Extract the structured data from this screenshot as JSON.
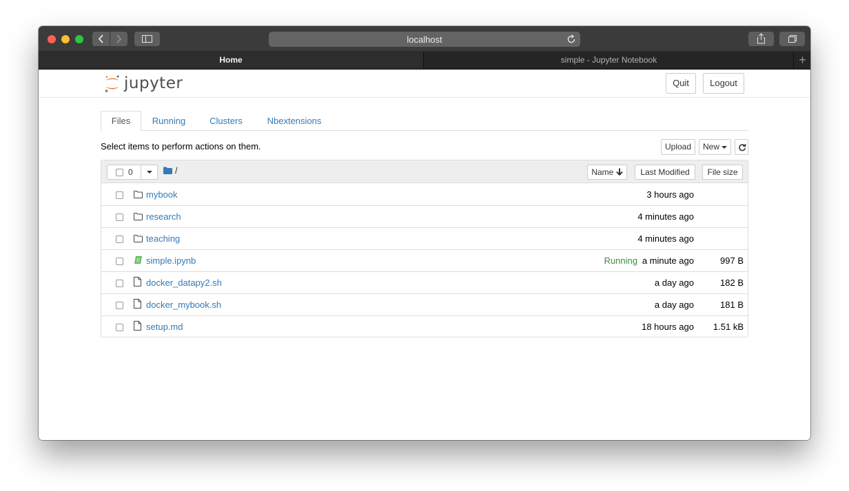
{
  "browser": {
    "url": "localhost",
    "tabs": [
      {
        "label": "Home",
        "active": true
      },
      {
        "label": "simple - Jupyter Notebook",
        "active": false
      }
    ],
    "add_tab_symbol": "+"
  },
  "header": {
    "logo_text": "jupyter",
    "quit_label": "Quit",
    "logout_label": "Logout"
  },
  "nav_tabs": [
    {
      "label": "Files"
    },
    {
      "label": "Running"
    },
    {
      "label": "Clusters"
    },
    {
      "label": "Nbextensions"
    }
  ],
  "toolbar": {
    "instruction": "Select items to perform actions on them.",
    "upload_label": "Upload",
    "new_label": "New"
  },
  "list_header": {
    "selected_count": "0",
    "path": "/",
    "sort_name_label": "Name",
    "sort_modified_label": "Last Modified",
    "sort_size_label": "File size"
  },
  "items": [
    {
      "name": "mybook",
      "type": "folder",
      "status": "",
      "modified": "3 hours ago",
      "size": ""
    },
    {
      "name": "research",
      "type": "folder",
      "status": "",
      "modified": "4 minutes ago",
      "size": ""
    },
    {
      "name": "teaching",
      "type": "folder",
      "status": "",
      "modified": "4 minutes ago",
      "size": ""
    },
    {
      "name": "simple.ipynb",
      "type": "notebook",
      "status": "Running",
      "modified": "a minute ago",
      "size": "997 B"
    },
    {
      "name": "docker_datapy2.sh",
      "type": "file",
      "status": "",
      "modified": "a day ago",
      "size": "182 B"
    },
    {
      "name": "docker_mybook.sh",
      "type": "file",
      "status": "",
      "modified": "a day ago",
      "size": "181 B"
    },
    {
      "name": "setup.md",
      "type": "file",
      "status": "",
      "modified": "18 hours ago",
      "size": "1.51 kB"
    }
  ],
  "colors": {
    "link": "#337ab7",
    "running": "#3c8d3c",
    "notebook_icon": "#5cb85c",
    "jupyter_orange": "#f37726"
  }
}
